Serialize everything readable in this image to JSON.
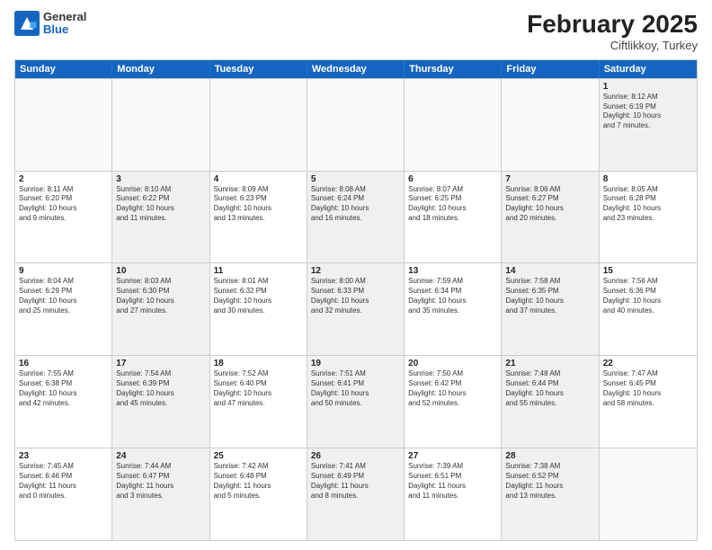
{
  "header": {
    "logo_general": "General",
    "logo_blue": "Blue",
    "month_title": "February 2025",
    "subtitle": "Ciftlikkoy, Turkey"
  },
  "days": [
    "Sunday",
    "Monday",
    "Tuesday",
    "Wednesday",
    "Thursday",
    "Friday",
    "Saturday"
  ],
  "weeks": [
    [
      {
        "day": "",
        "detail": "",
        "shaded": false,
        "empty": true
      },
      {
        "day": "",
        "detail": "",
        "shaded": false,
        "empty": true
      },
      {
        "day": "",
        "detail": "",
        "shaded": false,
        "empty": true
      },
      {
        "day": "",
        "detail": "",
        "shaded": false,
        "empty": true
      },
      {
        "day": "",
        "detail": "",
        "shaded": false,
        "empty": true
      },
      {
        "day": "",
        "detail": "",
        "shaded": false,
        "empty": true
      },
      {
        "day": "1",
        "detail": "Sunrise: 8:12 AM\nSunset: 6:19 PM\nDaylight: 10 hours\nand 7 minutes.",
        "shaded": true,
        "empty": false
      }
    ],
    [
      {
        "day": "2",
        "detail": "Sunrise: 8:11 AM\nSunset: 6:20 PM\nDaylight: 10 hours\nand 9 minutes.",
        "shaded": false,
        "empty": false
      },
      {
        "day": "3",
        "detail": "Sunrise: 8:10 AM\nSunset: 6:22 PM\nDaylight: 10 hours\nand 11 minutes.",
        "shaded": true,
        "empty": false
      },
      {
        "day": "4",
        "detail": "Sunrise: 8:09 AM\nSunset: 6:23 PM\nDaylight: 10 hours\nand 13 minutes.",
        "shaded": false,
        "empty": false
      },
      {
        "day": "5",
        "detail": "Sunrise: 8:08 AM\nSunset: 6:24 PM\nDaylight: 10 hours\nand 16 minutes.",
        "shaded": true,
        "empty": false
      },
      {
        "day": "6",
        "detail": "Sunrise: 8:07 AM\nSunset: 6:25 PM\nDaylight: 10 hours\nand 18 minutes.",
        "shaded": false,
        "empty": false
      },
      {
        "day": "7",
        "detail": "Sunrise: 8:06 AM\nSunset: 6:27 PM\nDaylight: 10 hours\nand 20 minutes.",
        "shaded": true,
        "empty": false
      },
      {
        "day": "8",
        "detail": "Sunrise: 8:05 AM\nSunset: 6:28 PM\nDaylight: 10 hours\nand 23 minutes.",
        "shaded": false,
        "empty": false
      }
    ],
    [
      {
        "day": "9",
        "detail": "Sunrise: 8:04 AM\nSunset: 6:29 PM\nDaylight: 10 hours\nand 25 minutes.",
        "shaded": false,
        "empty": false
      },
      {
        "day": "10",
        "detail": "Sunrise: 8:03 AM\nSunset: 6:30 PM\nDaylight: 10 hours\nand 27 minutes.",
        "shaded": true,
        "empty": false
      },
      {
        "day": "11",
        "detail": "Sunrise: 8:01 AM\nSunset: 6:32 PM\nDaylight: 10 hours\nand 30 minutes.",
        "shaded": false,
        "empty": false
      },
      {
        "day": "12",
        "detail": "Sunrise: 8:00 AM\nSunset: 6:33 PM\nDaylight: 10 hours\nand 32 minutes.",
        "shaded": true,
        "empty": false
      },
      {
        "day": "13",
        "detail": "Sunrise: 7:59 AM\nSunset: 6:34 PM\nDaylight: 10 hours\nand 35 minutes.",
        "shaded": false,
        "empty": false
      },
      {
        "day": "14",
        "detail": "Sunrise: 7:58 AM\nSunset: 6:35 PM\nDaylight: 10 hours\nand 37 minutes.",
        "shaded": true,
        "empty": false
      },
      {
        "day": "15",
        "detail": "Sunrise: 7:56 AM\nSunset: 6:36 PM\nDaylight: 10 hours\nand 40 minutes.",
        "shaded": false,
        "empty": false
      }
    ],
    [
      {
        "day": "16",
        "detail": "Sunrise: 7:55 AM\nSunset: 6:38 PM\nDaylight: 10 hours\nand 42 minutes.",
        "shaded": false,
        "empty": false
      },
      {
        "day": "17",
        "detail": "Sunrise: 7:54 AM\nSunset: 6:39 PM\nDaylight: 10 hours\nand 45 minutes.",
        "shaded": true,
        "empty": false
      },
      {
        "day": "18",
        "detail": "Sunrise: 7:52 AM\nSunset: 6:40 PM\nDaylight: 10 hours\nand 47 minutes.",
        "shaded": false,
        "empty": false
      },
      {
        "day": "19",
        "detail": "Sunrise: 7:51 AM\nSunset: 6:41 PM\nDaylight: 10 hours\nand 50 minutes.",
        "shaded": true,
        "empty": false
      },
      {
        "day": "20",
        "detail": "Sunrise: 7:50 AM\nSunset: 6:42 PM\nDaylight: 10 hours\nand 52 minutes.",
        "shaded": false,
        "empty": false
      },
      {
        "day": "21",
        "detail": "Sunrise: 7:48 AM\nSunset: 6:44 PM\nDaylight: 10 hours\nand 55 minutes.",
        "shaded": true,
        "empty": false
      },
      {
        "day": "22",
        "detail": "Sunrise: 7:47 AM\nSunset: 6:45 PM\nDaylight: 10 hours\nand 58 minutes.",
        "shaded": false,
        "empty": false
      }
    ],
    [
      {
        "day": "23",
        "detail": "Sunrise: 7:45 AM\nSunset: 6:46 PM\nDaylight: 11 hours\nand 0 minutes.",
        "shaded": false,
        "empty": false
      },
      {
        "day": "24",
        "detail": "Sunrise: 7:44 AM\nSunset: 6:47 PM\nDaylight: 11 hours\nand 3 minutes.",
        "shaded": true,
        "empty": false
      },
      {
        "day": "25",
        "detail": "Sunrise: 7:42 AM\nSunset: 6:48 PM\nDaylight: 11 hours\nand 5 minutes.",
        "shaded": false,
        "empty": false
      },
      {
        "day": "26",
        "detail": "Sunrise: 7:41 AM\nSunset: 6:49 PM\nDaylight: 11 hours\nand 8 minutes.",
        "shaded": true,
        "empty": false
      },
      {
        "day": "27",
        "detail": "Sunrise: 7:39 AM\nSunset: 6:51 PM\nDaylight: 11 hours\nand 11 minutes.",
        "shaded": false,
        "empty": false
      },
      {
        "day": "28",
        "detail": "Sunrise: 7:38 AM\nSunset: 6:52 PM\nDaylight: 11 hours\nand 13 minutes.",
        "shaded": true,
        "empty": false
      },
      {
        "day": "",
        "detail": "",
        "shaded": false,
        "empty": true
      }
    ]
  ]
}
